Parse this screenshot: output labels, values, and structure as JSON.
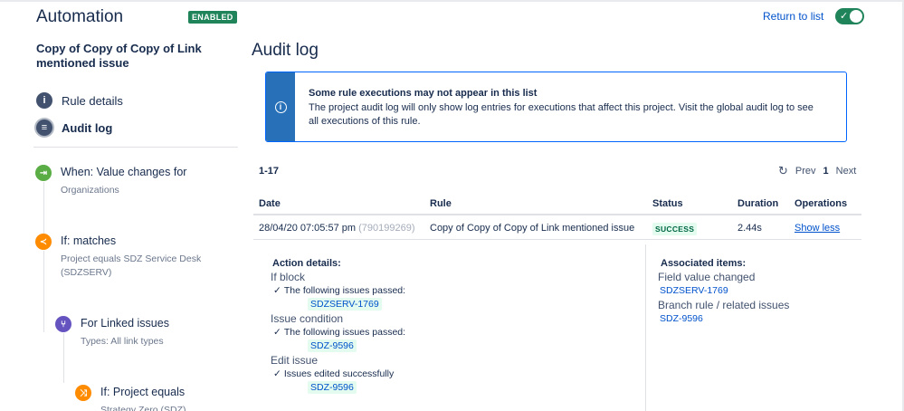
{
  "header": {
    "title": "Automation",
    "enabled_badge": "ENABLED",
    "return_link": "Return to list",
    "toggle_on": true,
    "accent_color": "#1f845a"
  },
  "sidebar": {
    "rule_name": "Copy of Copy of Copy of Link mentioned issue",
    "nav": [
      {
        "label": "Rule details",
        "icon": "info-icon"
      },
      {
        "label": "Audit log",
        "icon": "list-icon",
        "active": true
      }
    ],
    "components": [
      {
        "title": "When: Value changes for",
        "subtitle": "Organizations",
        "icon": "trigger-icon",
        "color": "#5aac44"
      },
      {
        "title": "If: matches",
        "subtitle": "Project equals SDZ Service Desk (SDZSERV)",
        "icon": "share-icon",
        "color": "#ff8b00"
      },
      {
        "title": "For Linked issues",
        "subtitle": "Types: All link types",
        "icon": "branch-icon",
        "color": "#6554c0"
      },
      {
        "title": "If: Project equals",
        "subtitle": "Strategy Zero (SDZ)",
        "icon": "shuffle-icon",
        "color": "#ff8b00"
      }
    ]
  },
  "main": {
    "title": "Audit log",
    "notice": {
      "title": "Some rule executions may not appear in this list",
      "body": "The project audit log will only show log entries for executions that affect this project. Visit the global audit log to see all executions of this rule."
    },
    "range": "1-17",
    "pager": {
      "prev": "Prev",
      "current": "1",
      "next": "Next"
    },
    "table": {
      "headers": {
        "date": "Date",
        "rule": "Rule",
        "status": "Status",
        "duration": "Duration",
        "operations": "Operations"
      },
      "row": {
        "date": "28/04/20 07:05:57 pm",
        "id": "(790199269)",
        "rule": "Copy of Copy of Copy of Link mentioned issue",
        "status": "SUCCESS",
        "duration": "2.44s",
        "operation": "Show less"
      }
    },
    "details": {
      "action_heading": "Action details:",
      "if_block": "If block",
      "if_block_msg": "The following issues passed:",
      "if_block_issue": "SDZSERV-1769",
      "issue_condition": "Issue condition",
      "issue_condition_msg": "The following issues passed:",
      "issue_condition_issue": "SDZ-9596",
      "edit_issue": "Edit issue",
      "edit_issue_msg": "Issues edited successfully",
      "edit_issue_issue": "SDZ-9596",
      "assoc_heading": "Associated items:",
      "field_value_changed": "Field value changed",
      "field_value_issue": "SDZSERV-1769",
      "branch_rule": "Branch rule / related issues",
      "branch_rule_issue": "SDZ-9596"
    }
  }
}
